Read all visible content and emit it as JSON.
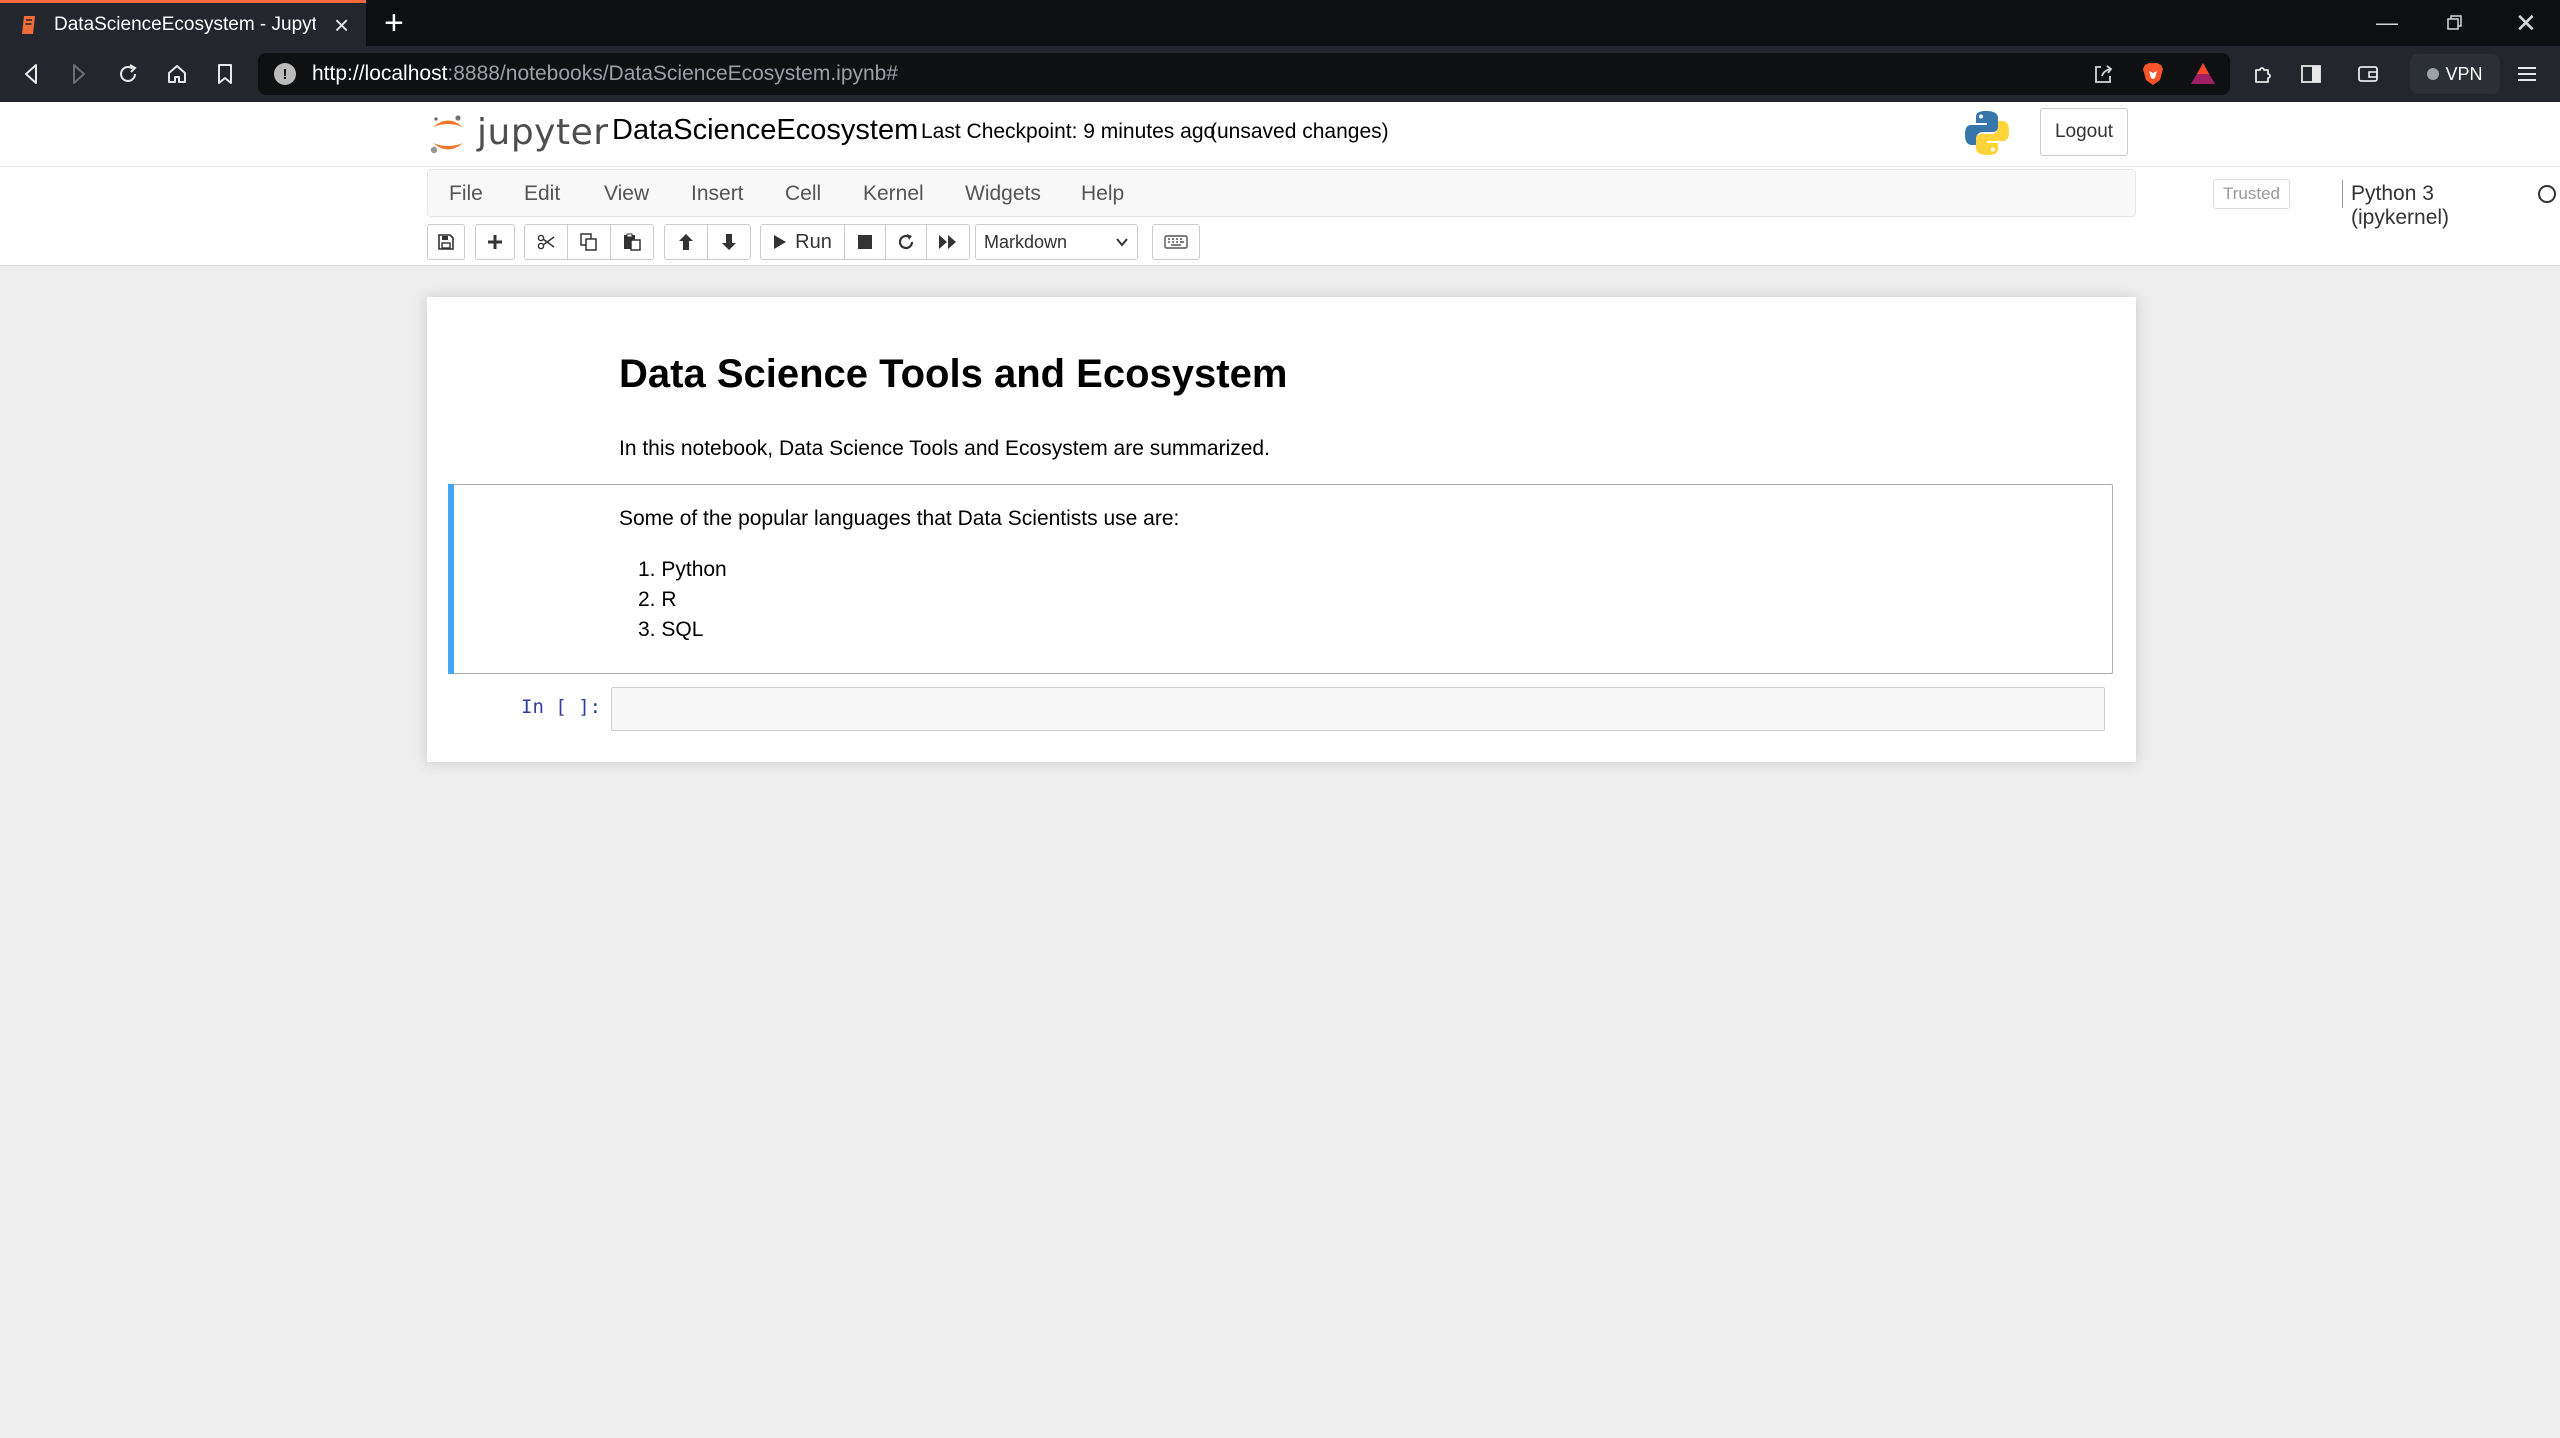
{
  "browser": {
    "tab_title": "DataScienceEcosystem - Jupyter",
    "url_host": "http://localhost",
    "url_rest": ":8888/notebooks/DataScienceEcosystem.ipynb#",
    "vpn_label": "VPN",
    "accent_color": "#f26b3a"
  },
  "jupyter": {
    "logo_text": "jupyter",
    "notebook_name": "DataScienceEcosystem",
    "checkpoint": "Last Checkpoint: 9 minutes ago",
    "unsaved": "(unsaved changes)",
    "logout_label": "Logout",
    "menu": [
      "File",
      "Edit",
      "View",
      "Insert",
      "Cell",
      "Kernel",
      "Widgets",
      "Help"
    ],
    "trusted_label": "Trusted",
    "kernel_name": "Python 3 (ipykernel)",
    "run_label": "Run",
    "cell_type": "Markdown"
  },
  "notebook": {
    "heading": "Data Science Tools and Ecosystem",
    "intro": "In this notebook, Data Science Tools and Ecosystem are summarized.",
    "languages_lead": "Some of the popular languages that Data Scientists use are:",
    "languages": [
      "1. Python",
      "2. R",
      "3. SQL"
    ],
    "prompt": "In [ ]:",
    "selected_cell_color": "#42a5f5"
  },
  "icons": [
    "tab-favicon-icon",
    "close-icon",
    "plus-icon",
    "back-icon",
    "forward-icon",
    "reload-icon",
    "home-icon",
    "bookmark-icon",
    "info-icon",
    "share-icon",
    "brave-icon",
    "bat-icon",
    "extensions-icon",
    "sidebar-icon",
    "wallet-icon",
    "menu-icon",
    "save-icon",
    "add-cell-icon",
    "cut-icon",
    "copy-icon",
    "paste-icon",
    "move-up-icon",
    "move-down-icon",
    "run-icon",
    "stop-icon",
    "restart-icon",
    "fast-forward-icon",
    "keyboard-icon",
    "python-logo-icon"
  ]
}
